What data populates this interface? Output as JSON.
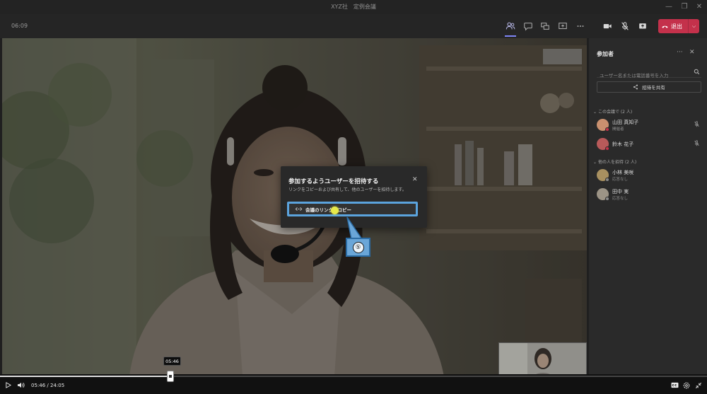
{
  "window": {
    "title": "XYZ社　定例会議"
  },
  "toolbar": {
    "timer": "06:09",
    "leave_label": "退出"
  },
  "participants": {
    "title": "参加者",
    "search_placeholder": "ユーザー名または電話番号を入力",
    "share_label": "招待を共有",
    "in_meeting_header": "この会議で (2 人)",
    "others_header": "他の人を招待 (2 人)",
    "in_meeting": [
      {
        "name": "山田 真知子",
        "role": "開催者",
        "avatar_color": "#c9906f",
        "status_color": "#c4314b"
      },
      {
        "name": "鈴木 花子",
        "role": "",
        "avatar_color": "#b85a5a",
        "status_color": "#c4314b"
      }
    ],
    "others": [
      {
        "name": "小林 美咲",
        "role": "応答なし",
        "avatar_color": "#a89060",
        "status_color": "#8a8a8a"
      },
      {
        "name": "田中 実",
        "role": "応答なし",
        "avatar_color": "#9c9486",
        "status_color": "#8a8a8a"
      }
    ]
  },
  "dialog": {
    "title": "参加するようユーザーを招待する",
    "description": "リンクをコピーおよび共有して、他のユーザーを招待します。",
    "copy_label": "会議のリンクをコピー"
  },
  "callout": {
    "number": "⑤"
  },
  "player": {
    "current": "05:46",
    "separator": "/",
    "duration": "24:05",
    "tooltip": "05:46",
    "progress": 0.24
  },
  "colors": {
    "accent": "#7f85f5",
    "leave": "#c4314b",
    "highlight": "#5ba3dd"
  }
}
